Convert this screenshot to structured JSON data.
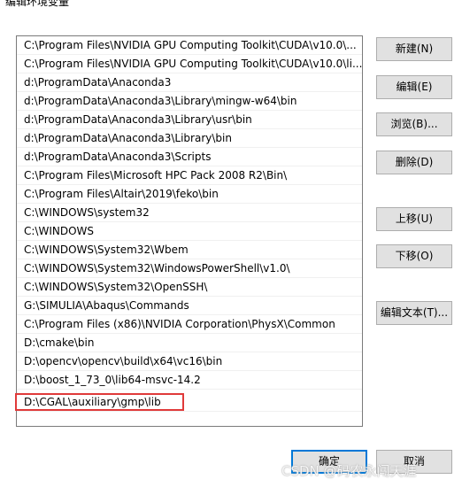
{
  "window": {
    "title": "编辑环境变量"
  },
  "paths": [
    "C:\\Program Files\\NVIDIA GPU Computing Toolkit\\CUDA\\v10.0\\...",
    "C:\\Program Files\\NVIDIA GPU Computing Toolkit\\CUDA\\v10.0\\li...",
    "d:\\ProgramData\\Anaconda3",
    "d:\\ProgramData\\Anaconda3\\Library\\mingw-w64\\bin",
    "d:\\ProgramData\\Anaconda3\\Library\\usr\\bin",
    "d:\\ProgramData\\Anaconda3\\Library\\bin",
    "d:\\ProgramData\\Anaconda3\\Scripts",
    "C:\\Program Files\\Microsoft HPC Pack 2008 R2\\Bin\\",
    "C:\\Program Files\\Altair\\2019\\feko\\bin",
    "C:\\WINDOWS\\system32",
    "C:\\WINDOWS",
    "C:\\WINDOWS\\System32\\Wbem",
    "C:\\WINDOWS\\System32\\WindowsPowerShell\\v1.0\\",
    "C:\\WINDOWS\\System32\\OpenSSH\\",
    "G:\\SIMULIA\\Abaqus\\Commands",
    "C:\\Program Files (x86)\\NVIDIA Corporation\\PhysX\\Common",
    "D:\\cmake\\bin",
    "D:\\opencv\\opencv\\build\\x64\\vc16\\bin",
    "D:\\boost_1_73_0\\lib64-msvc-14.2",
    "D:\\CGAL\\auxiliary\\gmp\\lib"
  ],
  "buttons": {
    "new": "新建(N)",
    "edit": "编辑(E)",
    "browse": "浏览(B)...",
    "delete": "删除(D)",
    "move_up": "上移(U)",
    "move_down": "下移(O)",
    "edit_text": "编辑文本(T)...",
    "ok": "确定",
    "cancel": "取消"
  },
  "watermark": "CSDN @码农永闯天涯",
  "colors": {
    "highlight": "#e03a3a",
    "focus": "#0078d7"
  }
}
